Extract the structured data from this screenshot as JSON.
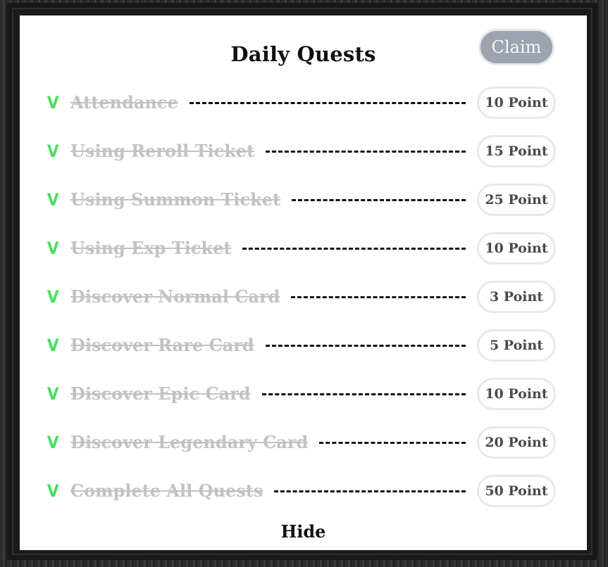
{
  "dialog": {
    "title": "Daily Quests",
    "claim_label": "Claim",
    "hide_label": "Hide"
  },
  "colors": {
    "claim_button_bg": "#9ea3b0",
    "check_green": "#48e05e",
    "completed_text": "#c2c2c6",
    "pill_border": "#e9e9ec"
  },
  "quests": [
    {
      "check": "V",
      "name": "Attendance",
      "points": "10 Point",
      "completed": true
    },
    {
      "check": "V",
      "name": "Using Reroll Ticket",
      "points": "15 Point",
      "completed": true
    },
    {
      "check": "V",
      "name": "Using Summon Ticket",
      "points": "25 Point",
      "completed": true
    },
    {
      "check": "V",
      "name": "Using Exp Ticket",
      "points": "10 Point",
      "completed": true
    },
    {
      "check": "V",
      "name": "Discover Normal Card",
      "points": "3 Point",
      "completed": true
    },
    {
      "check": "V",
      "name": "Discover Rare Card",
      "points": "5 Point",
      "completed": true
    },
    {
      "check": "V",
      "name": "Discover Epic Card",
      "points": "10 Point",
      "completed": true
    },
    {
      "check": "V",
      "name": "Discover Legendary Card",
      "points": "20 Point",
      "completed": true
    },
    {
      "check": "V",
      "name": "Complete All Quests",
      "points": "50 Point",
      "completed": true
    }
  ]
}
